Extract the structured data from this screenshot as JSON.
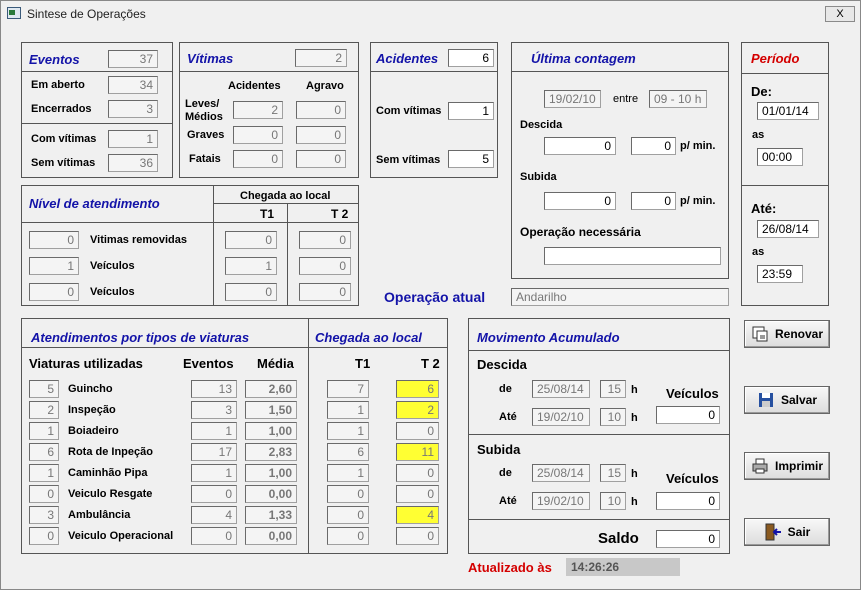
{
  "window": {
    "title": "Sintese de Operações",
    "close_label": "X"
  },
  "eventos": {
    "header": "Eventos",
    "total": "37",
    "rows": [
      {
        "label": "Em aberto",
        "value": "34"
      },
      {
        "label": "Encerrados",
        "value": "3"
      },
      {
        "label": "Com vítimas",
        "value": "1"
      },
      {
        "label": "Sem vítimas",
        "value": "36"
      }
    ]
  },
  "vitimas": {
    "header": "Vítimas",
    "total": "2",
    "col1": "Acidentes",
    "col2": "Agravo",
    "rows": [
      {
        "label": "Leves/\nMédios",
        "a": "2",
        "b": "0"
      },
      {
        "label": "Graves",
        "a": "0",
        "b": "0"
      },
      {
        "label": "Fatais",
        "a": "0",
        "b": "0"
      }
    ]
  },
  "acidentes": {
    "header": "Acidentes",
    "total": "6",
    "com_label": "Com vítimas",
    "com_value": "1",
    "sem_label": "Sem vítimas",
    "sem_value": "5"
  },
  "ultima": {
    "header": "Última contagem",
    "date": "19/02/10",
    "entre_label": "entre",
    "range": "09 - 10 h",
    "descida_label": "Descida",
    "descida_value": "0",
    "descida_rate": "0",
    "pmin": "p/ min.",
    "subida_label": "Subida",
    "subida_value": "0",
    "subida_rate": "0",
    "operacao_label": "Operação necessária",
    "operacao_value": ""
  },
  "periodo": {
    "header": "Período",
    "de_label": "De:",
    "de_date": "01/01/14",
    "as_label": "as",
    "de_time": "00:00",
    "ate_label": "Até:",
    "ate_date": "26/08/14",
    "ate_time": "23:59"
  },
  "nivel": {
    "header": "Nível de atendimento",
    "chegada": "Chegada ao local",
    "t1": "T1",
    "t2": "T 2",
    "rows": [
      {
        "count": "0",
        "label": "Vitimas removidas",
        "t1": "0",
        "t2": "0"
      },
      {
        "count": "1",
        "label": "Veículos",
        "t1": "1",
        "t2": "0"
      },
      {
        "count": "0",
        "label": "Veículos",
        "t1": "0",
        "t2": "0"
      }
    ]
  },
  "operacao_atual": {
    "label": "Operação atual",
    "value": "Andarilho"
  },
  "viaturas": {
    "header": "Atendimentos por tipos de viaturas",
    "col_util": "Viaturas utilizadas",
    "col_eventos": "Eventos",
    "col_media": "Média",
    "chegada_header": "Chegada ao local",
    "t1": "T1",
    "t2": "T 2",
    "rows": [
      {
        "n": "5",
        "label": "Guincho",
        "eventos": "13",
        "media": "2,60",
        "t1": "7",
        "t2": "6",
        "hl": true
      },
      {
        "n": "2",
        "label": "Inspeção",
        "eventos": "3",
        "media": "1,50",
        "t1": "1",
        "t2": "2",
        "hl": true
      },
      {
        "n": "1",
        "label": "Boiadeiro",
        "eventos": "1",
        "media": "1,00",
        "t1": "1",
        "t2": "0",
        "hl": false
      },
      {
        "n": "6",
        "label": "Rota de Inpeção",
        "eventos": "17",
        "media": "2,83",
        "t1": "6",
        "t2": "11",
        "hl": true
      },
      {
        "n": "1",
        "label": "Caminhão Pipa",
        "eventos": "1",
        "media": "1,00",
        "t1": "1",
        "t2": "0",
        "hl": false
      },
      {
        "n": "0",
        "label": "Veiculo Resgate",
        "eventos": "0",
        "media": "0,00",
        "t1": "0",
        "t2": "0",
        "hl": false
      },
      {
        "n": "3",
        "label": "Ambulância",
        "eventos": "4",
        "media": "1,33",
        "t1": "0",
        "t2": "4",
        "hl": true
      },
      {
        "n": "0",
        "label": "Veiculo Operacional",
        "eventos": "0",
        "media": "0,00",
        "t1": "0",
        "t2": "0",
        "hl": false
      }
    ]
  },
  "movimento": {
    "header": "Movimento Acumulado",
    "descida": {
      "label": "Descida",
      "de": "de",
      "de_date": "25/08/14",
      "de_h": "15",
      "h": "h",
      "ate": "Até",
      "ate_date": "19/02/10",
      "ate_h": "10",
      "veic_label": "Veículos",
      "veic": "0"
    },
    "subida": {
      "label": "Subida",
      "de": "de",
      "de_date": "25/08/14",
      "de_h": "15",
      "h": "h",
      "ate": "Até",
      "ate_date": "19/02/10",
      "ate_h": "10",
      "veic_label": "Veículos",
      "veic": "0"
    },
    "saldo_label": "Saldo",
    "saldo": "0"
  },
  "buttons": {
    "renovar": "Renovar",
    "salvar": "Salvar",
    "imprimir": "Imprimir",
    "sair": "Sair"
  },
  "atualizado": {
    "label": "Atualizado às",
    "time": "14:26:26"
  },
  "colors": {
    "header_blue": "#1313a8",
    "header_red": "#d40000",
    "highlight": "#ffff33"
  }
}
